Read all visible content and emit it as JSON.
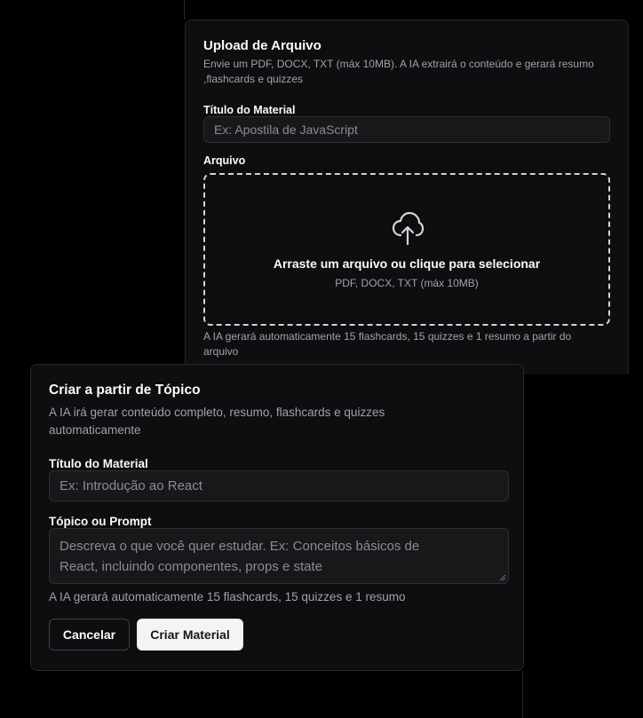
{
  "upload": {
    "title": "Upload de Arquivo",
    "description": "Envie um PDF, DOCX, TXT (máx 10MB). A IA extrairá o conteúdo e gerará resumo ,flashcards e quizzes",
    "title_label": "Título do Material",
    "title_placeholder": "Ex: Apostila de JavaScript",
    "file_label": "Arquivo",
    "drop_text": "Arraste um arquivo ou clique para selecionar",
    "drop_hint": "PDF, DOCX, TXT (máx 10MB)",
    "upload_icon": "cloud-upload-icon",
    "footer_note": "A IA gerará automaticamente 15 flashcards, 15 quizzes e 1 resumo a partir do arquivo"
  },
  "topic": {
    "title": "Criar a partir de Tópico",
    "description": "A IA irá gerar conteúdo completo, resumo, flashcards e quizzes automaticamente",
    "title_label": "Título do Material",
    "title_placeholder": "Ex: Introdução ao React",
    "prompt_label": "Tópico ou Prompt",
    "prompt_placeholder": "Descreva o que você quer estudar. Ex: Conceitos básicos de React, incluindo componentes, props e state",
    "footer_note": "A IA gerará automaticamente 15 flashcards, 15 quizzes e 1 resumo",
    "cancel_label": "Cancelar",
    "create_label": "Criar Material"
  },
  "colors": {
    "background": "#000000",
    "card": "#0e0e10",
    "primary_button": "#f4f4f5"
  }
}
